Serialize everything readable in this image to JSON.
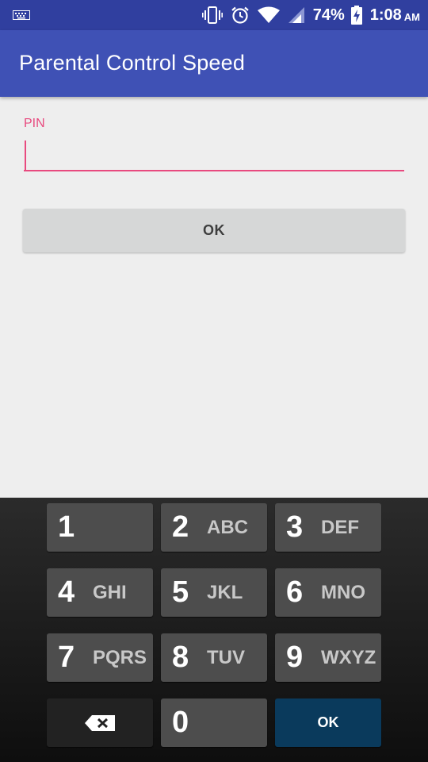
{
  "status_bar": {
    "battery": "74%",
    "time": "1:08",
    "ampm": "AM",
    "icons": [
      "keyboard-icon",
      "vibrate-icon",
      "alarm-icon",
      "wifi-icon",
      "signal-icon",
      "battery-charging-icon"
    ]
  },
  "app_bar": {
    "title": "Parental Control Speed",
    "color": "#3f51b5",
    "status_color": "#303f9f"
  },
  "form": {
    "pin_label": "PIN",
    "pin_value": "",
    "ok_label": "OK",
    "accent": "#e84a7f"
  },
  "keypad": {
    "keys": [
      {
        "digit": "1",
        "letters": ""
      },
      {
        "digit": "2",
        "letters": "ABC"
      },
      {
        "digit": "3",
        "letters": "DEF"
      },
      {
        "digit": "4",
        "letters": "GHI"
      },
      {
        "digit": "5",
        "letters": "JKL"
      },
      {
        "digit": "6",
        "letters": "MNO"
      },
      {
        "digit": "7",
        "letters": "PQRS"
      },
      {
        "digit": "8",
        "letters": "TUV"
      },
      {
        "digit": "9",
        "letters": "WXYZ"
      },
      {
        "digit": "0",
        "letters": ""
      }
    ],
    "delete_icon": "backspace-icon",
    "enter_label": "OK"
  }
}
